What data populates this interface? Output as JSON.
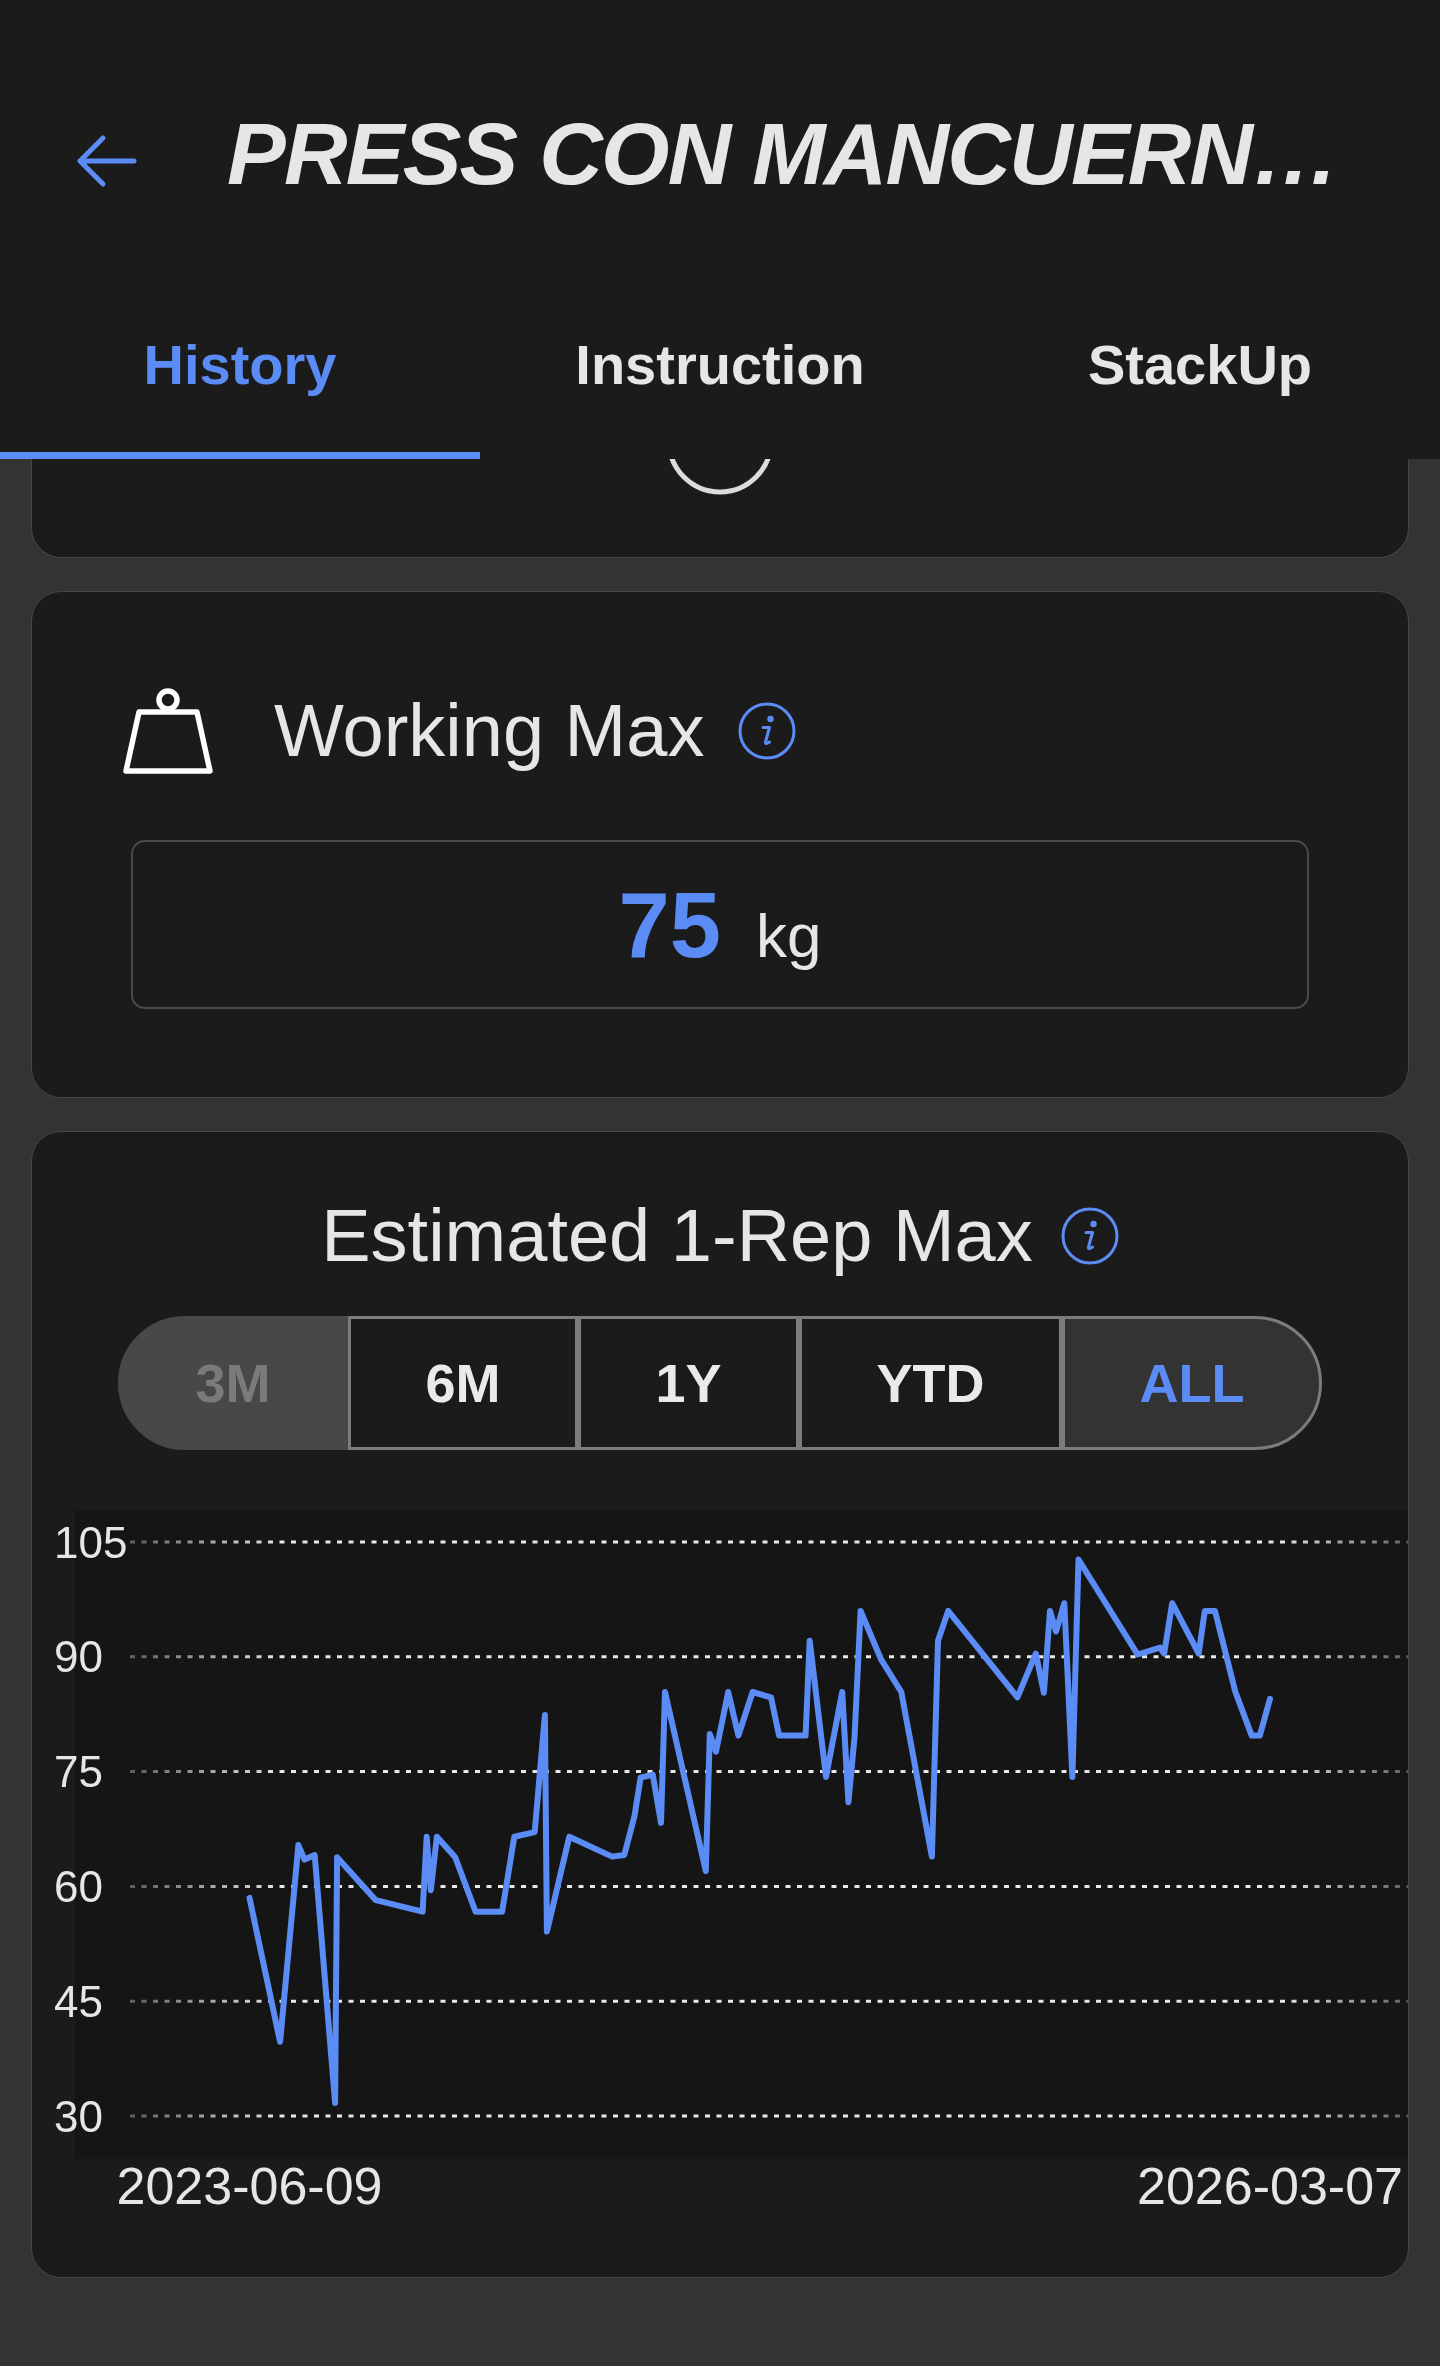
{
  "header": {
    "title": "PRESS CON MANCUERN…"
  },
  "tabs": [
    {
      "label": "History",
      "selected": true
    },
    {
      "label": "Instruction",
      "selected": false
    },
    {
      "label": "StackUp",
      "selected": false
    }
  ],
  "working_max": {
    "title": "Working Max",
    "value": "75",
    "unit": "kg"
  },
  "estimated_max": {
    "title": "Estimated 1-Rep Max",
    "ranges": [
      {
        "label": "3M",
        "selected": false,
        "disabled": true
      },
      {
        "label": "6M",
        "selected": false,
        "disabled": false
      },
      {
        "label": "1Y",
        "selected": false,
        "disabled": false
      },
      {
        "label": "YTD",
        "selected": false,
        "disabled": false
      },
      {
        "label": "ALL",
        "selected": true,
        "disabled": false
      }
    ],
    "chart_data": {
      "type": "line",
      "grid": true,
      "ylim": [
        30,
        105
      ],
      "yticks": [
        30,
        45,
        60,
        75,
        90,
        105
      ],
      "categories": [
        "2023-06-09",
        null,
        null,
        null,
        null,
        null,
        null,
        null,
        null,
        null,
        null,
        null,
        null,
        null,
        null,
        null,
        null,
        null,
        null,
        null,
        null,
        null,
        null,
        null,
        null,
        null,
        null,
        null,
        null,
        null,
        null,
        null,
        null,
        null,
        null,
        null,
        null,
        null,
        null,
        null,
        null,
        null,
        null,
        null,
        null,
        null,
        null,
        null,
        null,
        null,
        null,
        null,
        null,
        null,
        null,
        null,
        null,
        null,
        null,
        null,
        null,
        null,
        null,
        null,
        null,
        null,
        null,
        null,
        null,
        null,
        null,
        null,
        null,
        null,
        null,
        null,
        null,
        null,
        null,
        null,
        null,
        null,
        null,
        null,
        null,
        null,
        null,
        null,
        null,
        null,
        null,
        null,
        null,
        null,
        null,
        null,
        null,
        null,
        null,
        null,
        null,
        null,
        null,
        null,
        null,
        null,
        null,
        null,
        null,
        null,
        null,
        null,
        null,
        null,
        null,
        null,
        null,
        null,
        null,
        null,
        null,
        null,
        null,
        null,
        null,
        null,
        null,
        null,
        null,
        null,
        null,
        null,
        null,
        null,
        null,
        null,
        null,
        null,
        null,
        null,
        null,
        null,
        null,
        null,
        null,
        null,
        null,
        null,
        null,
        null,
        null,
        null,
        null,
        null,
        null,
        null,
        null,
        null,
        null,
        null,
        null,
        null,
        null,
        null,
        null,
        null,
        null,
        null,
        null,
        null,
        null,
        null,
        null,
        null,
        null,
        null,
        null,
        null,
        null,
        null,
        null,
        null,
        null,
        null,
        null,
        null,
        null,
        null,
        null,
        null,
        null,
        null,
        null,
        null,
        null,
        null,
        null,
        null,
        null,
        null,
        null,
        null,
        null,
        null,
        null,
        null,
        null,
        null,
        null,
        null,
        null,
        null,
        null,
        null,
        null,
        null,
        null,
        null,
        null,
        null,
        null,
        null,
        null,
        null,
        null,
        null,
        null,
        null,
        null,
        null,
        null,
        null,
        null,
        null,
        null,
        null,
        null,
        null,
        null,
        null,
        null,
        null,
        null,
        null,
        null,
        null,
        null,
        null,
        null,
        null,
        null,
        null,
        null,
        null,
        null,
        null,
        null,
        null,
        null,
        null,
        null,
        null,
        null,
        null,
        null,
        null,
        null,
        null,
        null,
        null,
        null,
        null,
        null,
        null,
        null,
        null,
        null,
        null,
        null,
        null,
        null,
        null,
        null,
        null,
        null,
        null,
        null,
        null,
        null,
        null,
        null,
        null,
        null,
        null,
        null,
        null,
        null,
        null,
        null,
        null,
        null,
        null,
        null,
        null,
        null,
        null,
        null,
        null,
        null,
        null,
        null,
        null,
        null,
        null,
        null,
        null,
        null,
        null,
        null,
        null,
        null,
        null,
        null,
        null,
        null,
        null,
        null,
        null,
        null,
        null,
        null,
        null,
        null,
        null,
        null,
        null,
        null,
        null,
        null,
        null,
        null,
        null,
        null,
        null,
        null,
        null,
        null,
        null,
        null,
        null,
        null,
        null,
        null,
        null,
        null,
        null,
        null,
        null,
        null,
        null,
        null,
        null,
        null,
        null,
        null,
        null,
        null,
        null,
        null,
        null,
        null,
        null,
        null,
        null,
        null,
        null,
        null,
        null,
        null,
        null,
        null,
        null,
        null,
        null,
        null,
        null,
        null,
        null,
        null,
        null,
        null,
        null,
        null,
        null,
        null,
        null,
        null,
        null,
        null,
        null,
        null,
        null,
        null,
        null,
        null,
        null,
        null,
        null,
        null,
        null,
        null,
        null,
        null,
        null,
        null,
        null,
        null,
        null,
        null,
        null,
        null,
        null,
        null,
        null,
        null,
        null,
        null,
        null,
        null,
        null,
        null,
        null,
        null,
        null,
        null,
        null,
        null,
        null,
        null,
        null,
        null,
        null,
        null,
        null,
        null,
        null,
        null,
        null,
        null,
        null,
        null,
        null,
        null,
        null,
        null,
        null,
        null,
        null,
        null,
        null,
        null,
        null,
        null,
        null,
        null,
        null,
        null,
        null,
        null,
        null,
        null,
        null,
        null,
        null,
        null,
        null,
        null,
        null,
        null,
        null,
        null,
        null,
        null,
        null,
        null,
        null,
        null,
        null,
        null,
        null,
        null,
        null,
        null,
        null,
        null,
        null,
        null,
        null,
        null,
        null,
        null,
        "2026-03-07"
      ],
      "series": [
        {
          "color": "#5b8cf5",
          "values": [
            58.5,
            null,
            null,
            null,
            null,
            null,
            null,
            null,
            null,
            null,
            null,
            null,
            null,
            null,
            null,
            39.7,
            null,
            null,
            null,
            null,
            null,
            null,
            null,
            null,
            65.4,
            null,
            null,
            63.5,
            null,
            null,
            null,
            null,
            64.1,
            null,
            null,
            null,
            null,
            null,
            null,
            null,
            null,
            null,
            31.7,
            63.8,
            null,
            null,
            null,
            null,
            null,
            null,
            null,
            null,
            null,
            null,
            null,
            null,
            null,
            null,
            null,
            null,
            null,
            null,
            58.2,
            null,
            null,
            null,
            null,
            null,
            null,
            null,
            null,
            null,
            null,
            null,
            null,
            null,
            null,
            null,
            null,
            null,
            null,
            null,
            null,
            null,
            null,
            56.7,
            null,
            66.5,
            null,
            59.5,
            null,
            null,
            66.5,
            null,
            null,
            null,
            null,
            null,
            null,
            null,
            null,
            63.8,
            null,
            null,
            null,
            null,
            null,
            null,
            null,
            null,
            null,
            56.7,
            null,
            null,
            null,
            null,
            null,
            null,
            null,
            null,
            null,
            null,
            null,
            null,
            56.7,
            null,
            null,
            null,
            null,
            null,
            66.5,
            null,
            null,
            null,
            null,
            null,
            null,
            null,
            null,
            null,
            67.1,
            null,
            null,
            null,
            null,
            82.4,
            54.1,
            null,
            null,
            null,
            null,
            null,
            null,
            null,
            null,
            null,
            null,
            66.5,
            null,
            null,
            null,
            null,
            null,
            null,
            null,
            null,
            null,
            null,
            null,
            null,
            null,
            null,
            null,
            null,
            null,
            null,
            null,
            null,
            63.9,
            null,
            null,
            null,
            null,
            null,
            64.1,
            null,
            null,
            null,
            null,
            69.2,
            null,
            null,
            74.2,
            null,
            null,
            null,
            null,
            null,
            74.6,
            null,
            null,
            null,
            68.3,
            null,
            85.4,
            null,
            null,
            null,
            null,
            null,
            null,
            null,
            null,
            null,
            null,
            null,
            null,
            null,
            null,
            null,
            null,
            null,
            null,
            null,
            62.0,
            null,
            79.9,
            null,
            null,
            77.6,
            null,
            null,
            null,
            null,
            null,
            85.4,
            null,
            null,
            null,
            null,
            79.7,
            null,
            null,
            null,
            null,
            null,
            null,
            85.4,
            null,
            null,
            null,
            null,
            null,
            null,
            null,
            null,
            84.7,
            null,
            null,
            null,
            79.7,
            null,
            null,
            null,
            null,
            null,
            null,
            null,
            null,
            null,
            null,
            null,
            null,
            79.7,
            null,
            92.1,
            null,
            null,
            null,
            null,
            null,
            null,
            null,
            74.3,
            null,
            null,
            null,
            null,
            null,
            null,
            null,
            85.4,
            null,
            null,
            71.0,
            null,
            null,
            79.4,
            null,
            null,
            96.0,
            null,
            null,
            null,
            null,
            null,
            null,
            null,
            null,
            null,
            89.7,
            null,
            null,
            null,
            null,
            null,
            null,
            null,
            null,
            null,
            85.4,
            null,
            null,
            null,
            null,
            null,
            null,
            null,
            null,
            null,
            null,
            null,
            null,
            null,
            null,
            63.9,
            null,
            null,
            92.1,
            null,
            null,
            null,
            null,
            96.0,
            null,
            null,
            null,
            null,
            null,
            null,
            null,
            null,
            null,
            null,
            null,
            null,
            null,
            null,
            null,
            null,
            null,
            null,
            null,
            null,
            null,
            null,
            null,
            null,
            null,
            null,
            null,
            null,
            null,
            null,
            null,
            null,
            null,
            84.7,
            null,
            null,
            null,
            null,
            null,
            null,
            null,
            null,
            90.4,
            null,
            null,
            null,
            85.3,
            null,
            null,
            96.0,
            null,
            null,
            93.3,
            null,
            null,
            null,
            97.0,
            null,
            null,
            null,
            74.3,
            null,
            null,
            102.7,
            null,
            null,
            null,
            null,
            null,
            null,
            null,
            null,
            null,
            null,
            null,
            null,
            null,
            null,
            null,
            null,
            null,
            null,
            null,
            null,
            null,
            null,
            null,
            null,
            null,
            null,
            null,
            null,
            90.3,
            null,
            null,
            null,
            null,
            null,
            null,
            null,
            null,
            null,
            null,
            91.2,
            null,
            90.4,
            null,
            null,
            null,
            97.0,
            null,
            null,
            null,
            null,
            null,
            null,
            null,
            null,
            null,
            null,
            null,
            null,
            90.4,
            null,
            null,
            96.0,
            null,
            null,
            null,
            null,
            96.0,
            null,
            null,
            null,
            null,
            null,
            null,
            null,
            null,
            null,
            85.4,
            null,
            null,
            null,
            null,
            null,
            null,
            null,
            79.7,
            null,
            null,
            null,
            79.7,
            null,
            null,
            null,
            null,
            84.5
          ]
        }
      ]
    }
  }
}
